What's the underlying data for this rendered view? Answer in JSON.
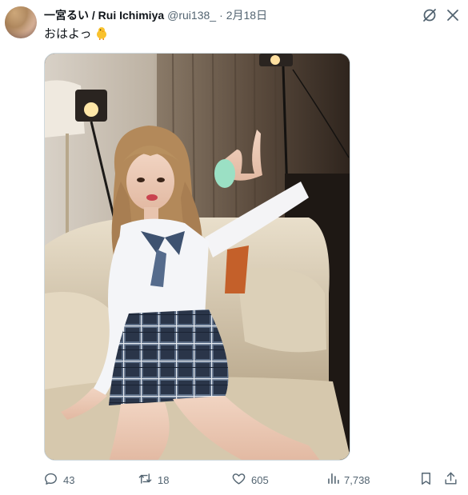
{
  "tweet": {
    "display_name": "一宮るい / Rui Ichimiya",
    "handle": "@rui138_",
    "separator": "·",
    "date": "2月18日",
    "text": "おはよっ",
    "emoji_icon": "baby-chick-icon"
  },
  "media": {
    "icon": "photo",
    "alt": ""
  },
  "actions": {
    "reply_count": "43",
    "retweet_count": "18",
    "like_count": "605",
    "views_count": "7,738"
  },
  "colors": {
    "text_primary": "#0f1419",
    "text_secondary": "#536471",
    "border": "#cfd9de"
  }
}
